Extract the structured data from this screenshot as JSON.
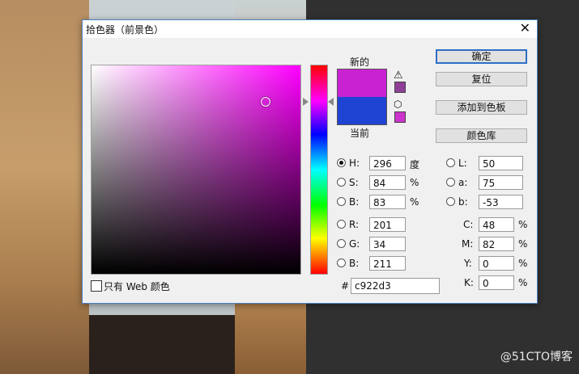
{
  "dialog": {
    "title": "拾色器（前景色）",
    "close_glyph": "✕"
  },
  "swatch": {
    "new_label": "新的",
    "current_label": "当前",
    "new_color": "#c922d3",
    "current_color": "#1f43d2",
    "gamut_swatch_color": "#8e3f98",
    "web_swatch_color": "#cc33cc"
  },
  "icons": {
    "warning": "warning-triangle-icon",
    "cube": "cube-icon"
  },
  "buttons": {
    "ok": "确定",
    "reset": "复位",
    "add_swatches": "添加到色板",
    "color_libraries": "颜色库"
  },
  "hsb": {
    "h": {
      "label": "H:",
      "value": "296",
      "unit": "度",
      "selected": true
    },
    "s": {
      "label": "S:",
      "value": "84",
      "unit": "%",
      "selected": false
    },
    "b": {
      "label": "B:",
      "value": "83",
      "unit": "%",
      "selected": false
    }
  },
  "rgb": {
    "r": {
      "label": "R:",
      "value": "201"
    },
    "g": {
      "label": "G:",
      "value": "34"
    },
    "b": {
      "label": "B:",
      "value": "211"
    }
  },
  "lab": {
    "l": {
      "label": "L:",
      "value": "50"
    },
    "a": {
      "label": "a:",
      "value": "75"
    },
    "b": {
      "label": "b:",
      "value": "-53"
    }
  },
  "cmyk": {
    "c": {
      "label": "C:",
      "value": "48",
      "unit": "%"
    },
    "m": {
      "label": "M:",
      "value": "82",
      "unit": "%"
    },
    "y": {
      "label": "Y:",
      "value": "0",
      "unit": "%"
    },
    "k": {
      "label": "K:",
      "value": "0",
      "unit": "%"
    }
  },
  "web_only_label": "只有 Web 颜色",
  "hex": {
    "label": "#",
    "value": "c922d3"
  },
  "watermark": "@51CTO博客"
}
